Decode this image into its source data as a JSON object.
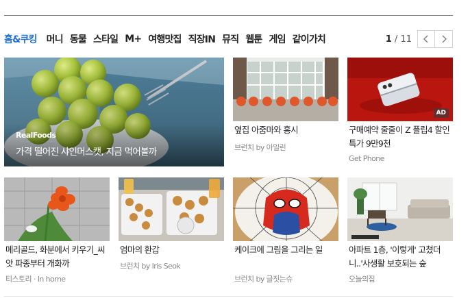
{
  "tabs": [
    "홈&쿠킹",
    "머니",
    "동물",
    "스타일",
    "M+",
    "여행맛집",
    "직장IN",
    "뮤직",
    "웹툰",
    "게임",
    "같이가치"
  ],
  "pager": {
    "current": "1",
    "separator": "/",
    "total": "11"
  },
  "feature": {
    "brand": "RealFoods",
    "title": "가격 떨어진 샤인머스캣, 지금 먹어볼까"
  },
  "cards": [
    {
      "title": "옆집 아줌마와 홍시",
      "source": "브런치 by 아일린"
    },
    {
      "title": "구매예약 줄줄이 Z 플립4 할인 특가 9만9천",
      "source": "Get Phone",
      "badge": "AD"
    },
    {
      "title": "메리골드, 화분에서 키우기_씨앗 파종부터 개화까",
      "source": "티스토리 · In home"
    },
    {
      "title": "엄마의 환갑",
      "source": "브런치 by Iris Seok"
    },
    {
      "title": "케이크에 그림을 그리는 일",
      "source": "브런치 by 글짓는슈"
    },
    {
      "title": "아파트 1층, '이렇게' 고쳤더니..'사생활 보호되는 숲",
      "source": "오늘의집"
    }
  ]
}
